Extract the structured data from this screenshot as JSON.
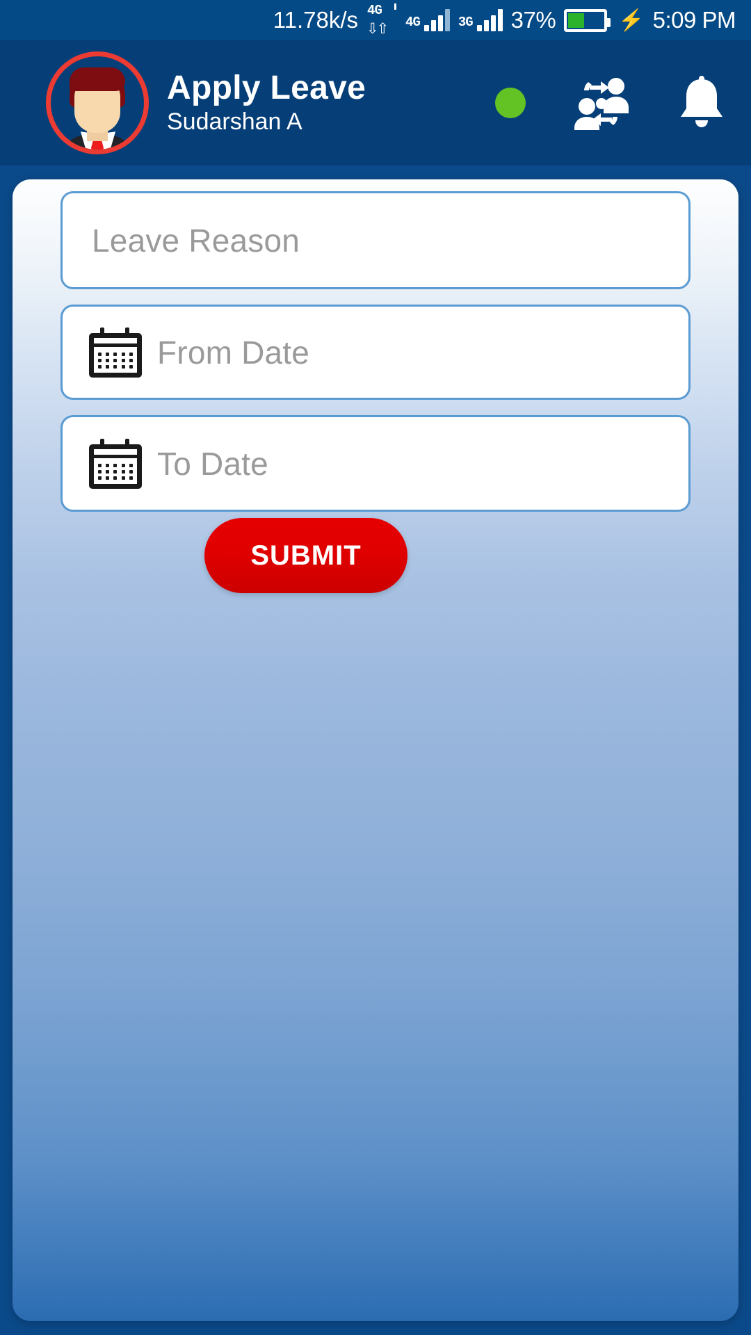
{
  "status_bar": {
    "network_speed": "11.78k/s",
    "data_indicator_label": "4G",
    "sim1_label": "4G",
    "sim2_label": "3G",
    "battery_percent": "37%",
    "battery_level": 37,
    "charging": true,
    "clock": "5:09 PM"
  },
  "header": {
    "title": "Apply Leave",
    "subtitle": "Sudarshan A",
    "avatar_name": "user-avatar",
    "status_dot_color": "#63c224",
    "actions": [
      {
        "name": "online-status-dot",
        "label": ""
      },
      {
        "name": "switch-user-icon",
        "label": ""
      },
      {
        "name": "notification-bell-icon",
        "label": ""
      }
    ]
  },
  "form": {
    "leave_reason": {
      "placeholder": "Leave Reason",
      "value": ""
    },
    "from_date": {
      "placeholder": "From Date",
      "value": ""
    },
    "to_date": {
      "placeholder": "To Date",
      "value": ""
    },
    "submit_label": "SUBMIT"
  },
  "colors": {
    "status_bar_bg": "#044a86",
    "header_bg": "#063f78",
    "field_border": "#5a9bd2",
    "placeholder_text": "#9a9a9a",
    "submit_bg": "#e00000",
    "avatar_ring": "#ec3b33"
  }
}
